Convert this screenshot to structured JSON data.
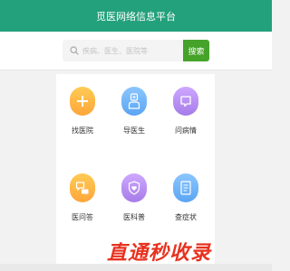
{
  "header": {
    "title": "觅医网络信息平台"
  },
  "search": {
    "placeholder": "疾病、医生、医院等",
    "button_label": "搜索",
    "button_color": "#46a32a"
  },
  "theme": {
    "header_color": "#23a07c"
  },
  "services": [
    {
      "label": "找医院",
      "icon": "plus-icon",
      "color": "#fdb341"
    },
    {
      "label": "导医生",
      "icon": "doctor-icon",
      "color": "#6fb2f5"
    },
    {
      "label": "问病情",
      "icon": "chat-icon",
      "color": "#b98cf0"
    },
    {
      "label": "医问答",
      "icon": "qa-icon",
      "color": "#fdb341"
    },
    {
      "label": "医科普",
      "icon": "heart-shield-icon",
      "color": "#b98cf0"
    },
    {
      "label": "查症状",
      "icon": "document-icon",
      "color": "#6fb2f5"
    }
  ],
  "watermark": {
    "text": "直通秒收录"
  }
}
